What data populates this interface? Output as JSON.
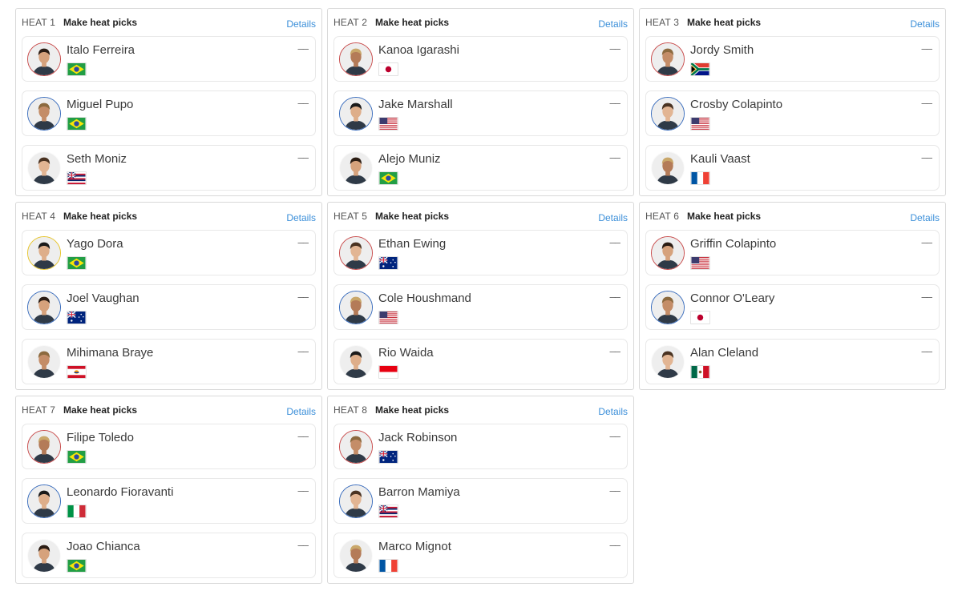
{
  "score_placeholder": "––",
  "details_label": "Details",
  "make_picks_label": "Make heat picks",
  "heats": [
    {
      "label": "HEAT 1",
      "surfers": [
        {
          "name": "Italo Ferreira",
          "country": "brazil-flag-icon",
          "ring": "red"
        },
        {
          "name": "Miguel Pupo",
          "country": "brazil-flag-icon",
          "ring": "blue"
        },
        {
          "name": "Seth Moniz",
          "country": "hawaii-flag-icon",
          "ring": "none"
        }
      ]
    },
    {
      "label": "HEAT 2",
      "surfers": [
        {
          "name": "Kanoa Igarashi",
          "country": "japan-flag-icon",
          "ring": "red"
        },
        {
          "name": "Jake Marshall",
          "country": "usa-flag-icon",
          "ring": "blue"
        },
        {
          "name": "Alejo Muniz",
          "country": "brazil-flag-icon",
          "ring": "none"
        }
      ]
    },
    {
      "label": "HEAT 3",
      "surfers": [
        {
          "name": "Jordy Smith",
          "country": "south-africa-flag-icon",
          "ring": "red"
        },
        {
          "name": "Crosby Colapinto",
          "country": "usa-flag-icon",
          "ring": "blue"
        },
        {
          "name": "Kauli Vaast",
          "country": "france-flag-icon",
          "ring": "none"
        }
      ]
    },
    {
      "label": "HEAT 4",
      "surfers": [
        {
          "name": "Yago Dora",
          "country": "brazil-flag-icon",
          "ring": "yellow"
        },
        {
          "name": "Joel Vaughan",
          "country": "australia-flag-icon",
          "ring": "blue"
        },
        {
          "name": "Mihimana Braye",
          "country": "tahiti-flag-icon",
          "ring": "none"
        }
      ]
    },
    {
      "label": "HEAT 5",
      "surfers": [
        {
          "name": "Ethan Ewing",
          "country": "australia-flag-icon",
          "ring": "red"
        },
        {
          "name": "Cole Houshmand",
          "country": "usa-flag-icon",
          "ring": "blue"
        },
        {
          "name": "Rio Waida",
          "country": "indonesia-flag-icon",
          "ring": "none"
        }
      ]
    },
    {
      "label": "HEAT 6",
      "surfers": [
        {
          "name": "Griffin Colapinto",
          "country": "usa-flag-icon",
          "ring": "red"
        },
        {
          "name": "Connor O'Leary",
          "country": "japan-flag-icon",
          "ring": "blue"
        },
        {
          "name": "Alan Cleland",
          "country": "mexico-flag-icon",
          "ring": "none"
        }
      ]
    },
    {
      "label": "HEAT 7",
      "surfers": [
        {
          "name": "Filipe Toledo",
          "country": "brazil-flag-icon",
          "ring": "red"
        },
        {
          "name": "Leonardo Fioravanti",
          "country": "italy-flag-icon",
          "ring": "blue"
        },
        {
          "name": "Joao Chianca",
          "country": "brazil-flag-icon",
          "ring": "none"
        }
      ]
    },
    {
      "label": "HEAT 8",
      "surfers": [
        {
          "name": "Jack Robinson",
          "country": "australia-flag-icon",
          "ring": "red"
        },
        {
          "name": "Barron Mamiya",
          "country": "hawaii-flag-icon",
          "ring": "blue"
        },
        {
          "name": "Marco Mignot",
          "country": "france-flag-icon",
          "ring": "none"
        }
      ]
    }
  ],
  "colors": {
    "ring_red": "#c84a4a",
    "ring_blue": "#3a6dbd",
    "ring_yellow": "#e6c42a",
    "details_link": "#3b8fd9",
    "card_border": "#d9d9d9"
  }
}
